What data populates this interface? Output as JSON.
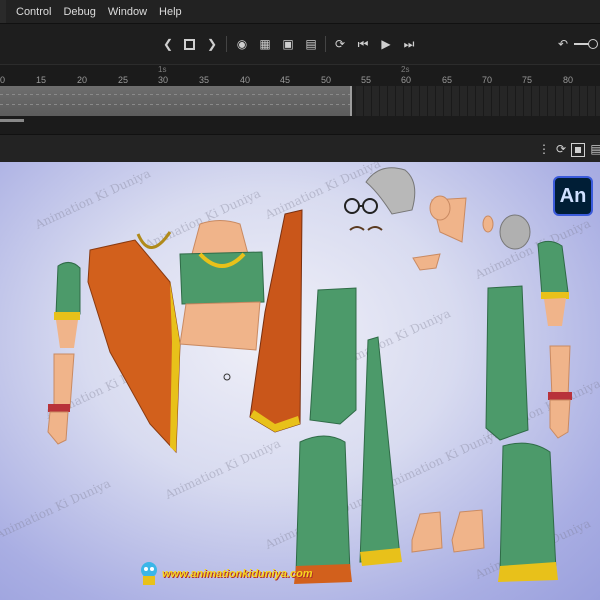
{
  "menu": {
    "items": [
      "Control",
      "Debug",
      "Window",
      "Help"
    ]
  },
  "timeline": {
    "frame_labels": [
      "0",
      "15",
      "20",
      "25",
      "30",
      "35",
      "40",
      "45",
      "50",
      "55",
      "60",
      "65",
      "70",
      "75",
      "80"
    ],
    "second_markers": [
      "1s",
      "2s"
    ]
  },
  "stage": {
    "watermark_text": "Animation Ki Duniya",
    "app_badge": "An",
    "website": "www.animationkiduniya.com"
  },
  "icons": {
    "step_back": "chevron-left-icon",
    "stop": "stop-icon",
    "step_forward": "chevron-right-icon",
    "play": "play-icon",
    "loop": "loop-icon",
    "rewind": "rewind-icon",
    "forward": "fast-forward-icon"
  },
  "colors": {
    "accent_blue": "#3b5bdb",
    "saree_orange": "#d2601c",
    "blouse_green": "#4c9a6a",
    "border_gold": "#e8c11a"
  }
}
